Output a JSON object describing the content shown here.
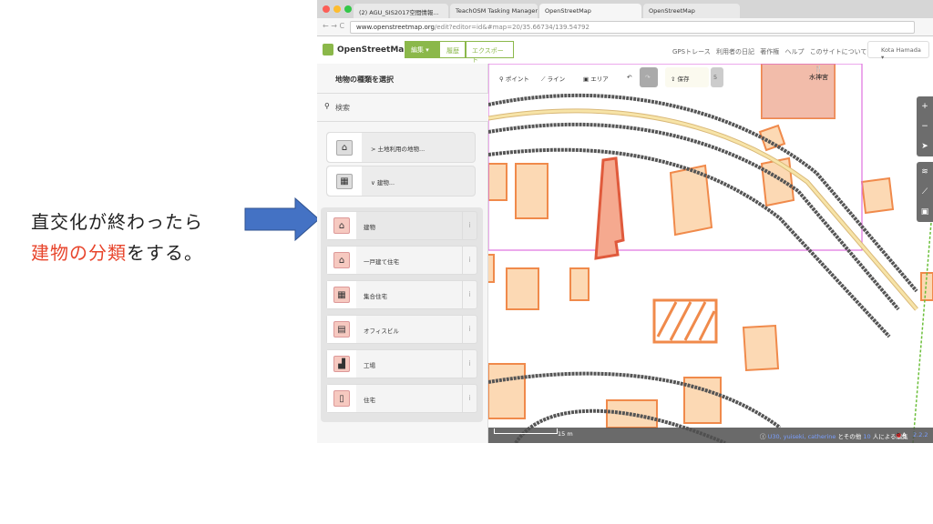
{
  "slide": {
    "line1": "直交化が終わったら",
    "line2_red": "建物の分類",
    "line2_black": "をする。",
    "arrow_color": "#4472c4"
  },
  "browser": {
    "tabs": [
      "(2) AGU_SIS2017空間情報...",
      "TeachOSM Tasking Manager -",
      "OpenStreetMap",
      "OpenStreetMap"
    ],
    "url_host": "www.openstreetmap.org",
    "url_path": "/edit?editor=id&#map=20/35.66734/139.54792"
  },
  "osm_header": {
    "logo": "OpenStreetMap",
    "edit": "編集",
    "history": "履歴",
    "export": "エクスポート",
    "nav": [
      "GPSトレース",
      "利用者の日記",
      "著作権",
      "ヘルプ",
      "このサイトについて"
    ],
    "user": "Kota Hamada"
  },
  "sidebar": {
    "title": "地物の種類を選択",
    "search_placeholder": "検索",
    "categories": [
      {
        "label": "> 土地利用の地物...",
        "icon": "landuse-icon"
      },
      {
        "label": "∨ 建物...",
        "icon": "building-icon"
      }
    ],
    "presets": [
      {
        "label": "建物",
        "icon": "house-icon"
      },
      {
        "label": "一戸建て住宅",
        "icon": "house-icon"
      },
      {
        "label": "集合住宅",
        "icon": "apartments-icon"
      },
      {
        "label": "オフィスビル",
        "icon": "commercial-icon"
      },
      {
        "label": "工場",
        "icon": "industrial-icon"
      },
      {
        "label": "住宅",
        "icon": "residential-icon"
      }
    ],
    "info": "i"
  },
  "map": {
    "toolbar": {
      "point": "ポイント",
      "line": "ライン",
      "area": "エリア",
      "save": "保存",
      "count": "5"
    },
    "poi": "水神宮",
    "scale": "15 m",
    "attribution_users": "U30, yuiseki, catherine",
    "attribution_rest": "とその他",
    "attribution_count": "10",
    "attribution_end": "人による編集",
    "version": "2.2.2"
  }
}
